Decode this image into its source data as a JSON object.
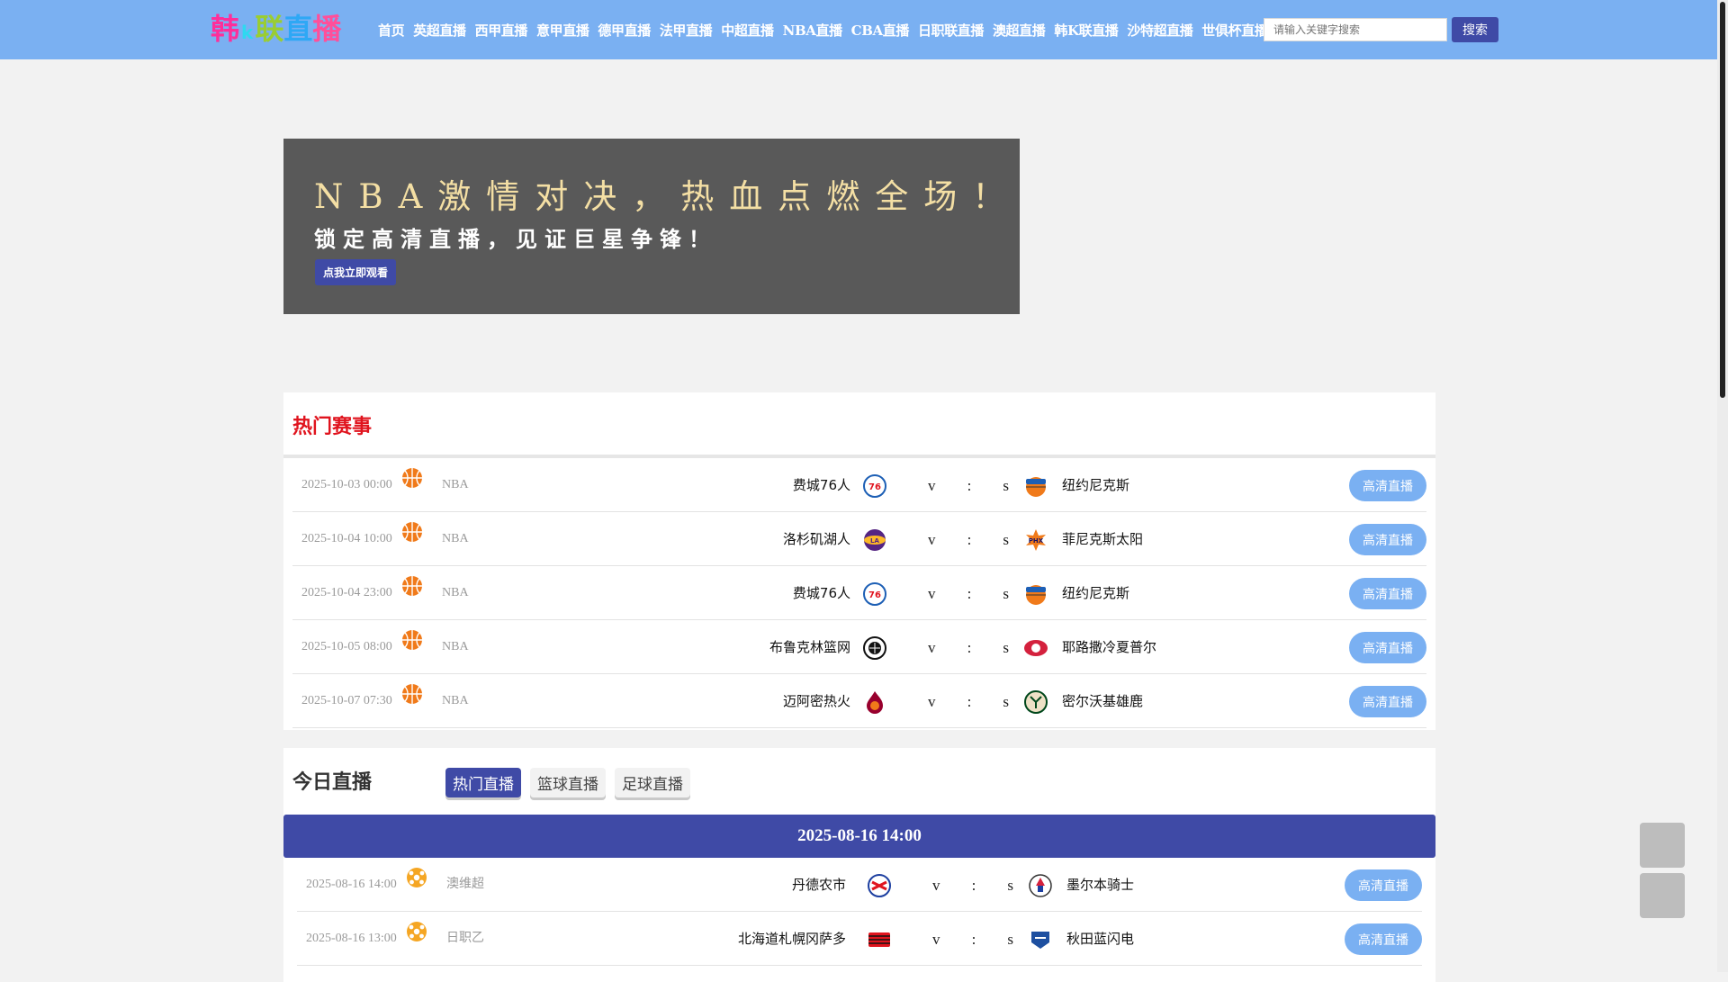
{
  "logo": {
    "chars": [
      {
        "ch": "韩",
        "color": "#ff2e9a"
      },
      {
        "ch": "k",
        "color": "#2ed9f0"
      },
      {
        "ch": "联",
        "color": "#9acd32"
      },
      {
        "ch": "直",
        "color": "#2ea8f5"
      },
      {
        "ch": "播",
        "color": "#ff4f9a"
      }
    ]
  },
  "nav": [
    "首页",
    "英超直播",
    "西甲直播",
    "意甲直播",
    "德甲直播",
    "法甲直播",
    "中超直播",
    "NBA直播",
    "CBA直播",
    "日职联直播",
    "澳超直播",
    "韩K联直播",
    "沙特超直播",
    "世俱杯直播"
  ],
  "search": {
    "placeholder": "请输入关键字搜索",
    "button": "搜索"
  },
  "banner": {
    "title": "NBA激情对决，热血点燃全场！",
    "subtitle": "锁定高清直播，见证巨星争锋！",
    "button": "点我立即观看"
  },
  "hot": {
    "title": "热门赛事",
    "rows": [
      {
        "time": "2025-10-03 00:00",
        "sport": "basketball",
        "league": "NBA",
        "home": "费城76人",
        "home_logo": "76ers",
        "away": "纽约尼克斯",
        "away_logo": "knicks",
        "live": "高清直播"
      },
      {
        "time": "2025-10-04 10:00",
        "sport": "basketball",
        "league": "NBA",
        "home": "洛杉矶湖人",
        "home_logo": "lakers",
        "away": "菲尼克斯太阳",
        "away_logo": "suns",
        "live": "高清直播"
      },
      {
        "time": "2025-10-04 23:00",
        "sport": "basketball",
        "league": "NBA",
        "home": "费城76人",
        "home_logo": "76ers",
        "away": "纽约尼克斯",
        "away_logo": "knicks",
        "live": "高清直播"
      },
      {
        "time": "2025-10-05 08:00",
        "sport": "basketball",
        "league": "NBA",
        "home": "布鲁克林篮网",
        "home_logo": "nets",
        "away": "耶路撒冷夏普尔",
        "away_logo": "hapoel",
        "live": "高清直播"
      },
      {
        "time": "2025-10-07 07:30",
        "sport": "basketball",
        "league": "NBA",
        "home": "迈阿密热火",
        "home_logo": "heat",
        "away": "密尔沃基雄鹿",
        "away_logo": "bucks",
        "live": "高清直播"
      }
    ]
  },
  "today": {
    "title": "今日直播",
    "tabs": [
      {
        "label": "热门直播",
        "active": true
      },
      {
        "label": "篮球直播",
        "active": false
      },
      {
        "label": "足球直播",
        "active": false
      }
    ],
    "date": "2025-08-16 14:00",
    "rows": [
      {
        "time": "2025-08-16 14:00",
        "sport": "soccer",
        "league": "澳维超",
        "home": "丹德农市",
        "home_logo": "dandenong",
        "away": "墨尔本骑士",
        "away_logo": "knights",
        "live": "高清直播"
      },
      {
        "time": "2025-08-16 13:00",
        "sport": "soccer",
        "league": "日职乙",
        "home": "北海道札幌冈萨多",
        "home_logo": "sapporo",
        "away": "秋田蓝闪电",
        "away_logo": "akita",
        "live": "高清直播"
      }
    ]
  },
  "vs": [
    "v",
    ":",
    "s"
  ],
  "colors": {
    "header": "#7ab0f2",
    "accent": "#3f4aa6",
    "hot": "#e0141e",
    "live_button": "#7ab0f2",
    "banner_bg": "#595959",
    "banner_title": "#f4dfa4"
  }
}
